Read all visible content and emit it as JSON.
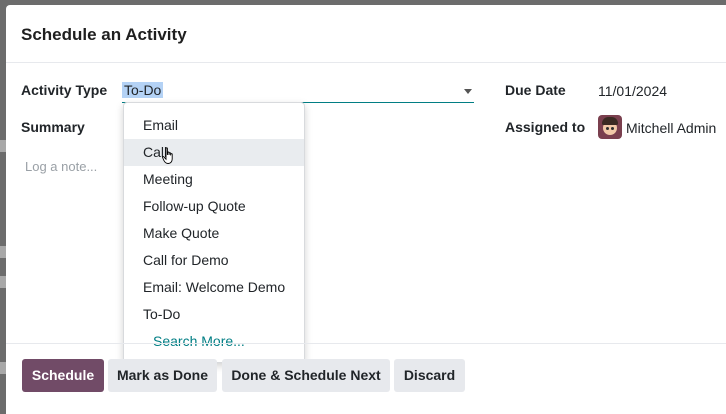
{
  "dialog": {
    "title": "Schedule an Activity"
  },
  "form": {
    "activity_type_label": "Activity Type",
    "activity_type_value": "To-Do",
    "summary_label": "Summary",
    "note_placeholder": "Log a note...",
    "due_date_label": "Due Date",
    "due_date_value": "11/01/2024",
    "assigned_to_label": "Assigned to",
    "assigned_to_value": "Mitchell Admin"
  },
  "dropdown": {
    "items": [
      {
        "label": "Email"
      },
      {
        "label": "Call"
      },
      {
        "label": "Meeting"
      },
      {
        "label": "Follow-up Quote"
      },
      {
        "label": "Make Quote"
      },
      {
        "label": "Call for Demo"
      },
      {
        "label": "Email: Welcome Demo"
      },
      {
        "label": "To-Do"
      }
    ],
    "hovered_item": "Call",
    "search_more": "Search More..."
  },
  "footer": {
    "schedule": "Schedule",
    "mark_as_done": "Mark as Done",
    "done_schedule_next": "Done & Schedule Next",
    "discard": "Discard"
  },
  "colors": {
    "primary": "#714b67",
    "accent": "#017e84",
    "selection": "#b4d2f5"
  },
  "icons": {
    "dropdown_caret": "caret-down-icon",
    "cursor": "hand-pointer-icon",
    "avatar": "user-avatar"
  }
}
